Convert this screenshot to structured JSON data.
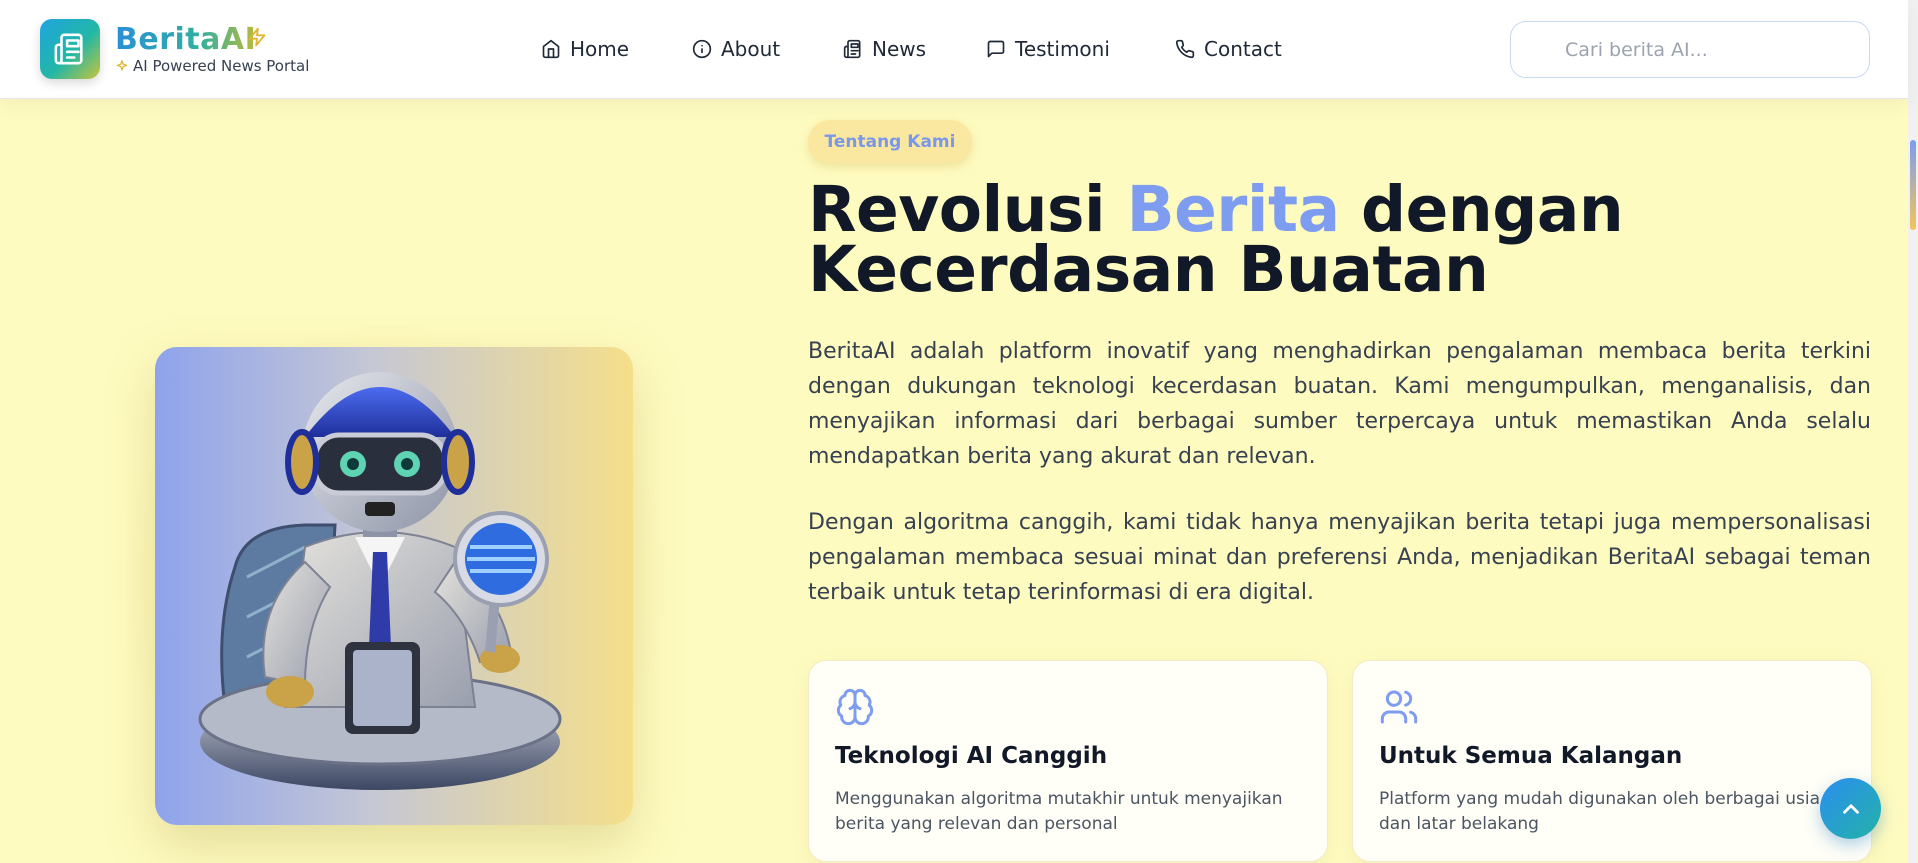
{
  "brand": {
    "name": "BeritaAI",
    "tagline": "AI Powered News Portal"
  },
  "nav": {
    "items": [
      {
        "label": "Home",
        "icon": "home-icon"
      },
      {
        "label": "About",
        "icon": "info-icon"
      },
      {
        "label": "News",
        "icon": "newspaper-icon"
      },
      {
        "label": "Testimoni",
        "icon": "message-square-icon"
      },
      {
        "label": "Contact",
        "icon": "phone-icon"
      }
    ]
  },
  "search": {
    "placeholder": "Cari berita AI..."
  },
  "hero": {
    "badge": "Tentang Kami",
    "title_part1": "Revolusi ",
    "title_highlight": "Berita",
    "title_part2": " dengan Kecerdasan Buatan",
    "paragraph1": "BeritaAI adalah platform inovatif yang menghadirkan pengalaman membaca berita terkini dengan dukungan teknologi kecerdasan buatan. Kami mengumpulkan, menganalisis, dan menyajikan informasi dari berbagai sumber terpercaya untuk memastikan Anda selalu mendapatkan berita yang akurat dan relevan.",
    "paragraph2": "Dengan algoritma canggih, kami tidak hanya menyajikan berita tetapi juga mempersonalisasi pengalaman membaca sesuai minat dan preferensi Anda, menjadikan BeritaAI sebagai teman terbaik untuk tetap terinformasi di era digital."
  },
  "features": [
    {
      "icon": "brain-icon",
      "title": "Teknologi AI Canggih",
      "description": "Menggunakan algoritma mutakhir untuk menyajikan berita yang relevan dan personal"
    },
    {
      "icon": "users-icon",
      "title": "Untuk Semua Kalangan",
      "description": "Platform yang mudah digunakan oleh berbagai usia dan latar belakang"
    }
  ],
  "colors": {
    "accent": "#7f9df0",
    "background": "#fefbc0",
    "brand_gradient_start": "#2a8fd8",
    "brand_gradient_end": "#b9bb3a"
  }
}
